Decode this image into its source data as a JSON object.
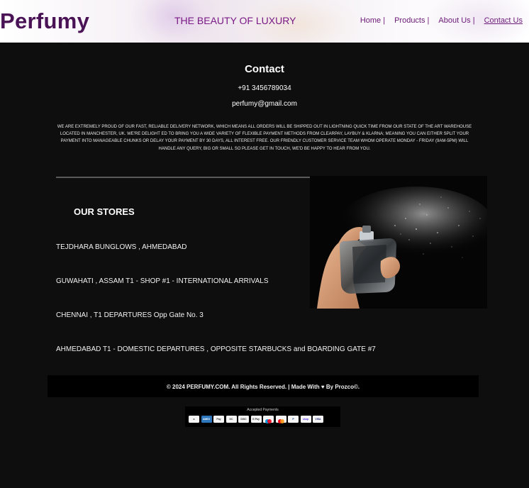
{
  "header": {
    "logo": "Perfumy",
    "tagline": "THE BEAUTY OF LUXURY",
    "nav": [
      "Home |",
      "Products |",
      "About Us |",
      "Contact Us"
    ],
    "active_nav": "Contact Us"
  },
  "contact": {
    "title": "Contact",
    "phone": "+91 3456789034",
    "email": "perfumy@gmail.com",
    "about": "WE ARE EXTREMELY PROUD OF OUR FAST, RELIABLE DELIVERY NETWORK, WHICH MEANS ALL ORDERS WILL BE SHIPPED OUT IN LIGHTNING QUICK TIME FROM OUR STATE OF THE ART WAREHOUSE LOCATED IN MANCHESTER, UK. WE'RE DELIGHT ED TO BRING YOU A WIDE VARIETY OF FLEXIBLE PAYMENT METHODS FROM CLEARPAY, LAYBUY & KLARNA; MEANING YOU CAN EITHER SPLIT YOUR PAYMENT INTO MANAGEABLE CHUNKS OR DELAY YOUR PAYMENT BY 30 DAYS, ALL INTEREST FREE. OUR FRIENDLY CUSTOMER SERVICE TEAM WHOM OPERATE MONDAY - FRIDAY (9AM-5PM) WILL HANDLE ANY QUERY, BIG OR SMALL SO PLEASE GET IN TOUCH, WE'D BE HAPPY TO HEAR FROM YOU."
  },
  "stores": {
    "title": "OUR STORES",
    "items": [
      "TEJDHARA BUNGLOWS , AHMEDABAD",
      "GUWAHATI , ASSAM T1 - SHOP #1 - INTERNATIONAL ARRIVALS",
      "CHENNAI , T1 DEPARTURES Opp Gate No. 3",
      "AHMEDABAD T1 - DOMESTIC DEPARTURES , OPPOSITE STARBUCKS and BOARDING GATE #7"
    ]
  },
  "footer": {
    "text": "© 2024 PERFUMY.COM. All Rights Reserved. | Made With ♥ By Prozco©."
  },
  "payments": {
    "label": "Accepted Payments",
    "cards": [
      {
        "name": "amazon-pay",
        "text": "a",
        "color": "#f5f5f5"
      },
      {
        "name": "amex",
        "text": "AMEX",
        "color": "#2e77bc"
      },
      {
        "name": "apple-pay",
        "text": "Pay",
        "color": "#f5f5f5"
      },
      {
        "name": "diners-club",
        "text": "DC",
        "color": "#f5f5f5"
      },
      {
        "name": "discover",
        "text": "DISC",
        "color": "#f5f5f5"
      },
      {
        "name": "google-pay",
        "text": "G Pay",
        "color": "#f5f5f5"
      },
      {
        "name": "maestro",
        "text": "",
        "color": "#f5f5f5"
      },
      {
        "name": "mastercard",
        "text": "",
        "color": "#f5f5f5"
      },
      {
        "name": "paypal",
        "text": "P",
        "color": "#f5f5f5"
      },
      {
        "name": "shop-pay",
        "text": "shop",
        "color": "#f5f5f5"
      },
      {
        "name": "visa",
        "text": "VISA",
        "color": "#f5f5f5"
      }
    ]
  },
  "colors": {
    "background": "#0e0e0e",
    "brand": "#4a1356",
    "nav": "#6b1a78"
  }
}
